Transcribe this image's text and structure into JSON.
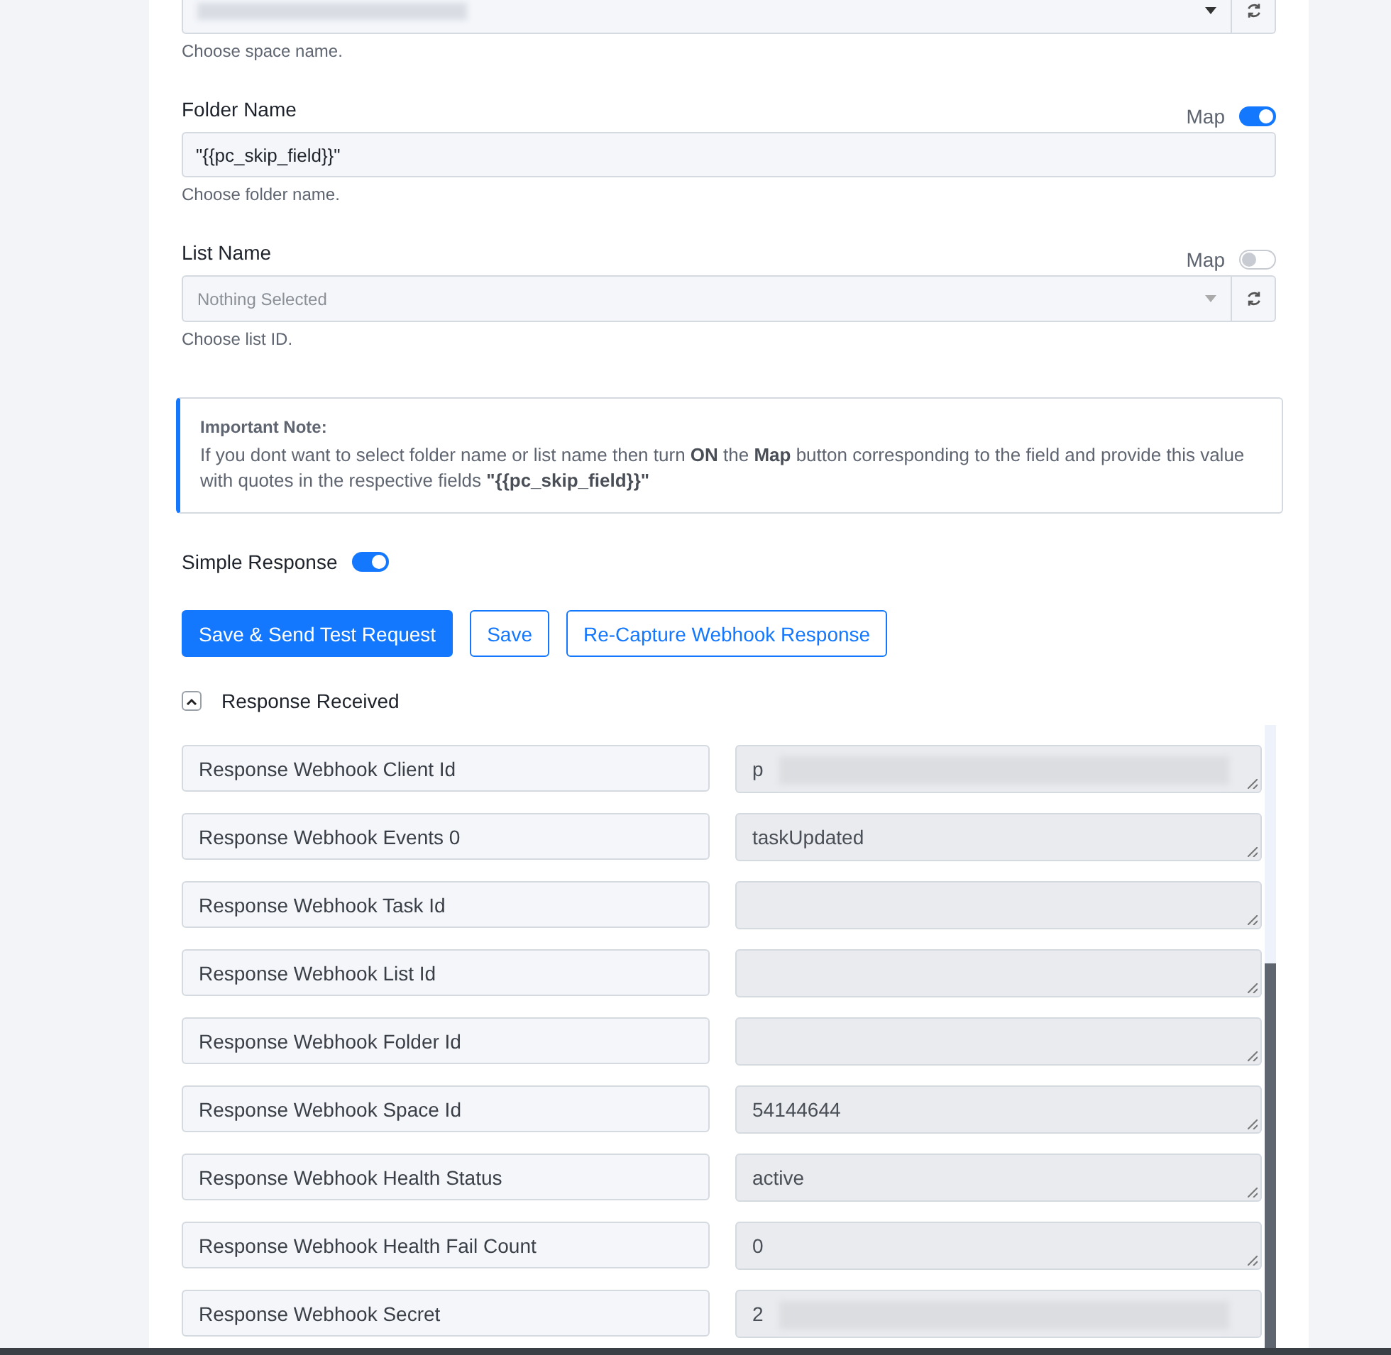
{
  "space_field": {
    "hint": "Choose space name.",
    "redacted": true
  },
  "folder_field": {
    "label": "Folder Name",
    "map_label": "Map",
    "map_on": true,
    "value": "\"{{pc_skip_field}}\"",
    "hint": "Choose folder name."
  },
  "list_field": {
    "label": "List Name",
    "map_label": "Map",
    "map_on": false,
    "placeholder": "Nothing Selected",
    "hint": "Choose list ID."
  },
  "note": {
    "title": "Important Note:",
    "text": "If you dont want to select folder name or list name then turn **ON** the **Map** button corresponding to the field and provide this value with quotes in the respective fields **\"{{pc_skip_field}}\"**"
  },
  "simple_response": {
    "label": "Simple Response",
    "on": true
  },
  "buttons": [
    {
      "label": "Save & Send Test Request",
      "kind": "primary"
    },
    {
      "label": "Save",
      "kind": "outline"
    },
    {
      "label": "Re-Capture Webhook Response",
      "kind": "outline"
    }
  ],
  "response": {
    "title": "Response Received",
    "expanded": true,
    "rows": [
      {
        "label": "Response Webhook Client Id",
        "value": "p",
        "redacted": true
      },
      {
        "label": "Response Webhook Events 0",
        "value": "taskUpdated",
        "redacted": false
      },
      {
        "label": "Response Webhook Task Id",
        "value": "",
        "redacted": false
      },
      {
        "label": "Response Webhook List Id",
        "value": "",
        "redacted": false
      },
      {
        "label": "Response Webhook Folder Id",
        "value": "",
        "redacted": false
      },
      {
        "label": "Response Webhook Space Id",
        "value": "54144644",
        "redacted": false
      },
      {
        "label": "Response Webhook Health Status",
        "value": "active",
        "redacted": false
      },
      {
        "label": "Response Webhook Health Fail Count",
        "value": "0",
        "redacted": false
      },
      {
        "label": "Response Webhook Secret",
        "value": "2",
        "redacted": true
      }
    ]
  }
}
